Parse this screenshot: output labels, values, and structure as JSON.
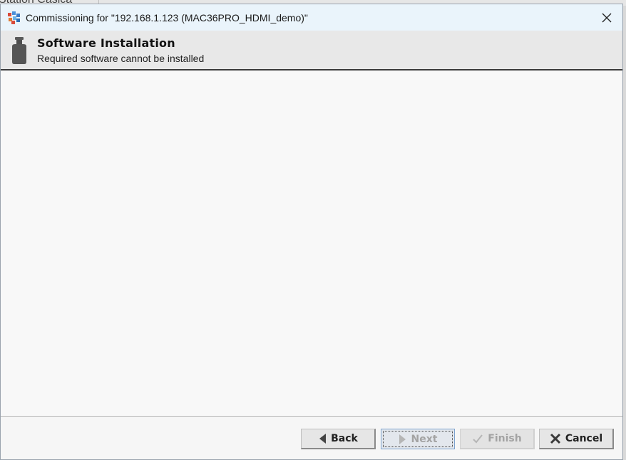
{
  "background": {
    "partial_title": "Station Casica"
  },
  "dialog": {
    "title": "Commissioning for \"192.168.1.123 (MAC36PRO_HDMI_demo)\"",
    "icons": {
      "app": "niagara-app-icon",
      "close": "close-icon",
      "header": "software-bottle-icon"
    }
  },
  "header": {
    "title": "Software Installation",
    "subtitle": "Required software cannot be installed"
  },
  "buttons": {
    "back": {
      "label": "Back",
      "icon": "arrow-left-icon",
      "enabled": true
    },
    "next": {
      "label": "Next",
      "icon": "arrow-right-icon",
      "enabled": false
    },
    "finish": {
      "label": "Finish",
      "icon": "check-icon",
      "enabled": false
    },
    "cancel": {
      "label": "Cancel",
      "icon": "x-icon",
      "enabled": true
    }
  },
  "colors": {
    "titlebar": "#eaf4fb",
    "header": "#e8e8e8",
    "content": "#f8f8f8"
  }
}
